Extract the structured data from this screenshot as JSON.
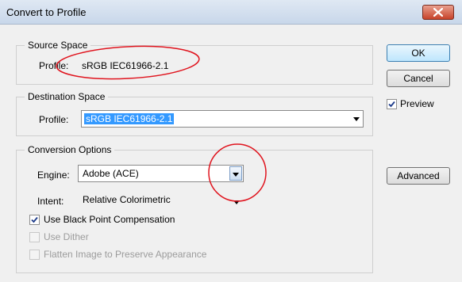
{
  "window": {
    "title": "Convert to Profile",
    "close_icon": "close-icon"
  },
  "source": {
    "group_label": "Source Space",
    "profile_label": "Profile:",
    "profile_value": "sRGB IEC61966-2.1"
  },
  "destination": {
    "group_label": "Destination Space",
    "profile_label": "Profile:",
    "profile_value": "sRGB IEC61966-2.1"
  },
  "conversion": {
    "group_label": "Conversion Options",
    "engine_label": "Engine:",
    "engine_value": "Adobe (ACE)",
    "intent_label": "Intent:",
    "intent_value": "Relative Colorimetric",
    "black_point": {
      "label": "Use Black Point Compensation",
      "checked": true
    },
    "dither": {
      "label": "Use Dither",
      "checked": false,
      "enabled": false
    },
    "flatten": {
      "label": "Flatten Image to Preserve Appearance",
      "checked": false,
      "enabled": false
    }
  },
  "buttons": {
    "ok": "OK",
    "cancel": "Cancel",
    "advanced": "Advanced"
  },
  "preview": {
    "label": "Preview",
    "checked": true
  },
  "colors": {
    "selection": "#3399ff",
    "annotation": "#e0141e"
  }
}
